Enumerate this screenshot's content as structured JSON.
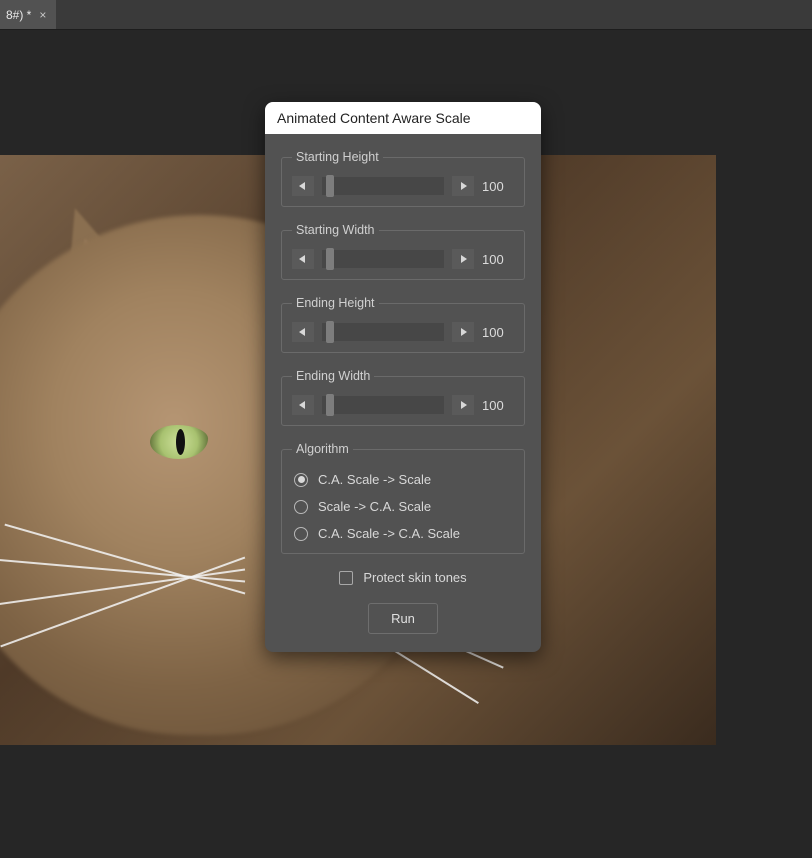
{
  "tab": {
    "label": "8#) *"
  },
  "dialog": {
    "title": "Animated Content Aware Scale",
    "sliders": {
      "startingHeight": {
        "label": "Starting Height",
        "value": "100"
      },
      "startingWidth": {
        "label": "Starting Width",
        "value": "100"
      },
      "endingHeight": {
        "label": "Ending Height",
        "value": "100"
      },
      "endingWidth": {
        "label": "Ending Width",
        "value": "100"
      }
    },
    "algorithm": {
      "legend": "Algorithm",
      "options": [
        "C.A. Scale -> Scale",
        "Scale -> C.A. Scale",
        "C.A. Scale -> C.A. Scale"
      ],
      "selectedIndex": 0
    },
    "protectSkinTones": {
      "label": "Protect skin tones",
      "checked": false
    },
    "runLabel": "Run"
  }
}
